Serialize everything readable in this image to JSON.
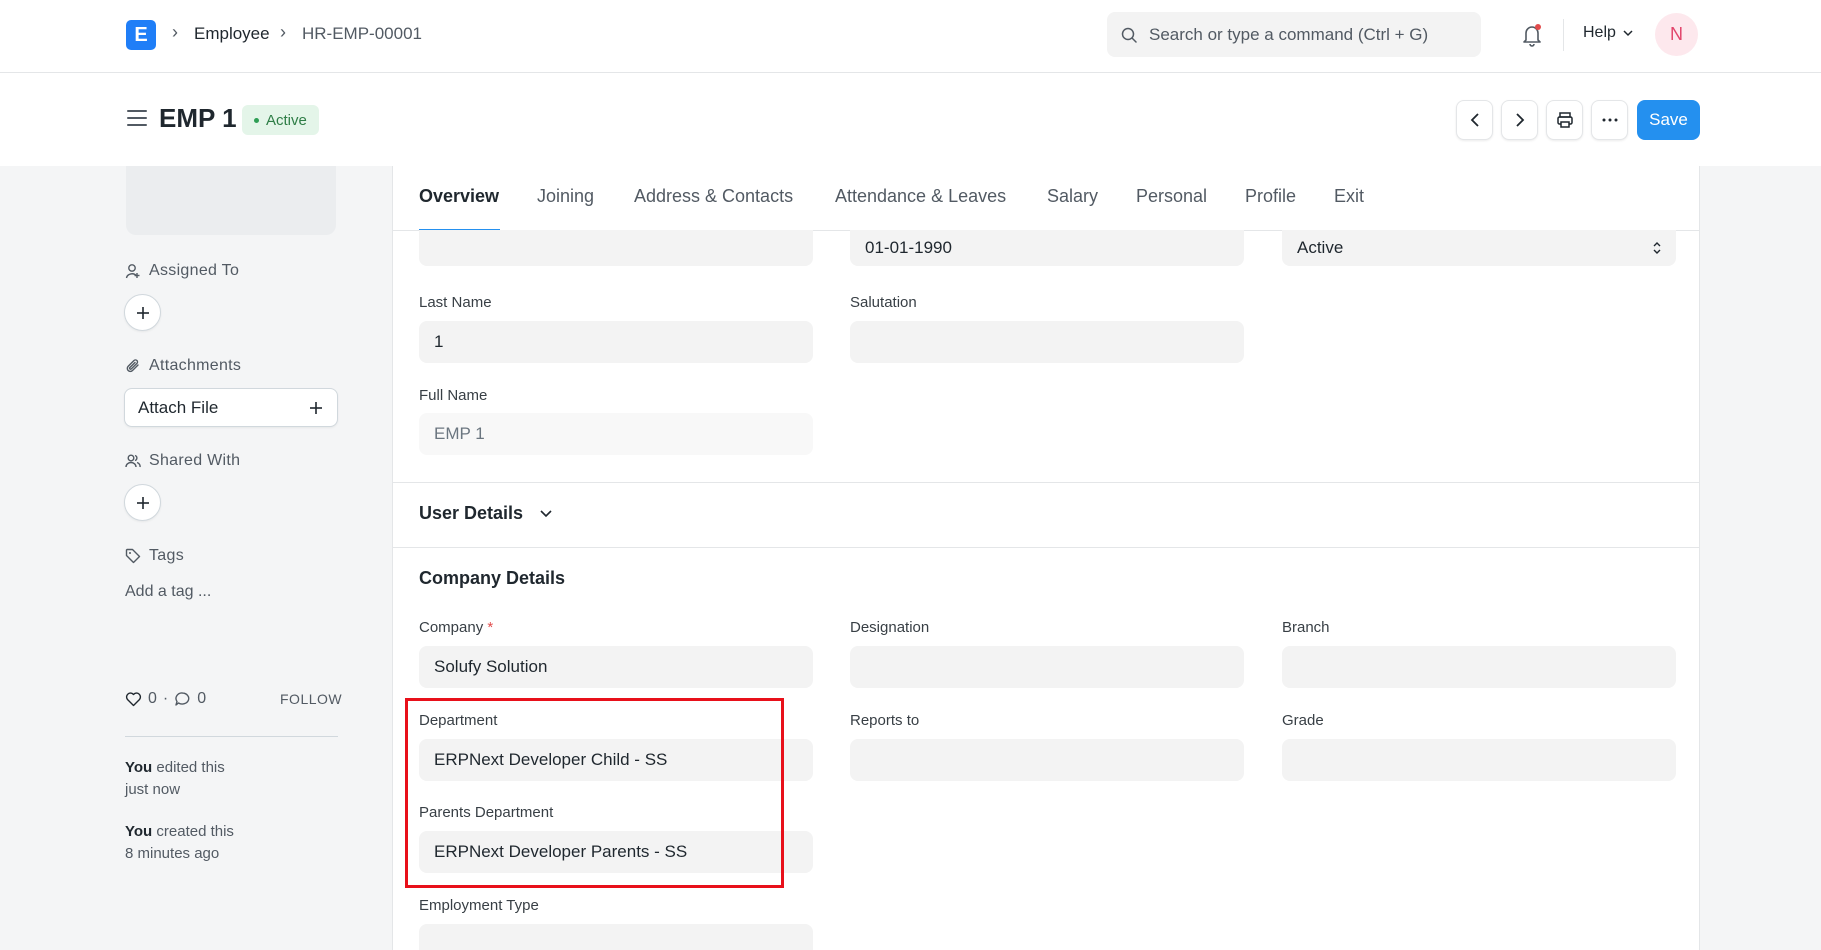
{
  "navbar": {
    "logo": "E",
    "breadcrumbs": [
      "Employee",
      "HR-EMP-00001"
    ],
    "search_placeholder": "Search or type a command (Ctrl + G)",
    "help_label": "Help",
    "avatar_initial": "N"
  },
  "header": {
    "title": "EMP 1",
    "status": "Active",
    "save_label": "Save"
  },
  "sidebar": {
    "assigned_to": "Assigned To",
    "attachments": "Attachments",
    "attach_file": "Attach File",
    "shared_with": "Shared With",
    "tags": "Tags",
    "add_tag": "Add a tag ...",
    "likes": "0",
    "comments": "0",
    "follow": "FOLLOW",
    "activity": [
      {
        "who": "You",
        "what": " edited this",
        "when": "just now"
      },
      {
        "who": "You",
        "what": " created this",
        "when": "8 minutes ago"
      }
    ]
  },
  "tabs": [
    "Overview",
    "Joining",
    "Address & Contacts",
    "Attendance & Leaves",
    "Salary",
    "Personal",
    "Profile",
    "Exit"
  ],
  "form": {
    "date_of_birth": "01-01-1990",
    "status": "Active",
    "last_name_label": "Last Name",
    "last_name": "1",
    "salutation_label": "Salutation",
    "full_name_label": "Full Name",
    "full_name": "EMP 1",
    "user_details": "User Details",
    "company_details": "Company Details",
    "company_label": "Company",
    "company": "Solufy Solution",
    "designation_label": "Designation",
    "branch_label": "Branch",
    "department_label": "Department",
    "department": "ERPNext Developer Child - SS",
    "reports_to_label": "Reports to",
    "grade_label": "Grade",
    "parents_department_label": "Parents Department",
    "parents_department": "ERPNext Developer Parents - SS",
    "employment_type_label": "Employment Type"
  },
  "colors": {
    "primary": "#2490ef",
    "highlight": "#e8101a",
    "status_bg": "#e4f5e9"
  }
}
